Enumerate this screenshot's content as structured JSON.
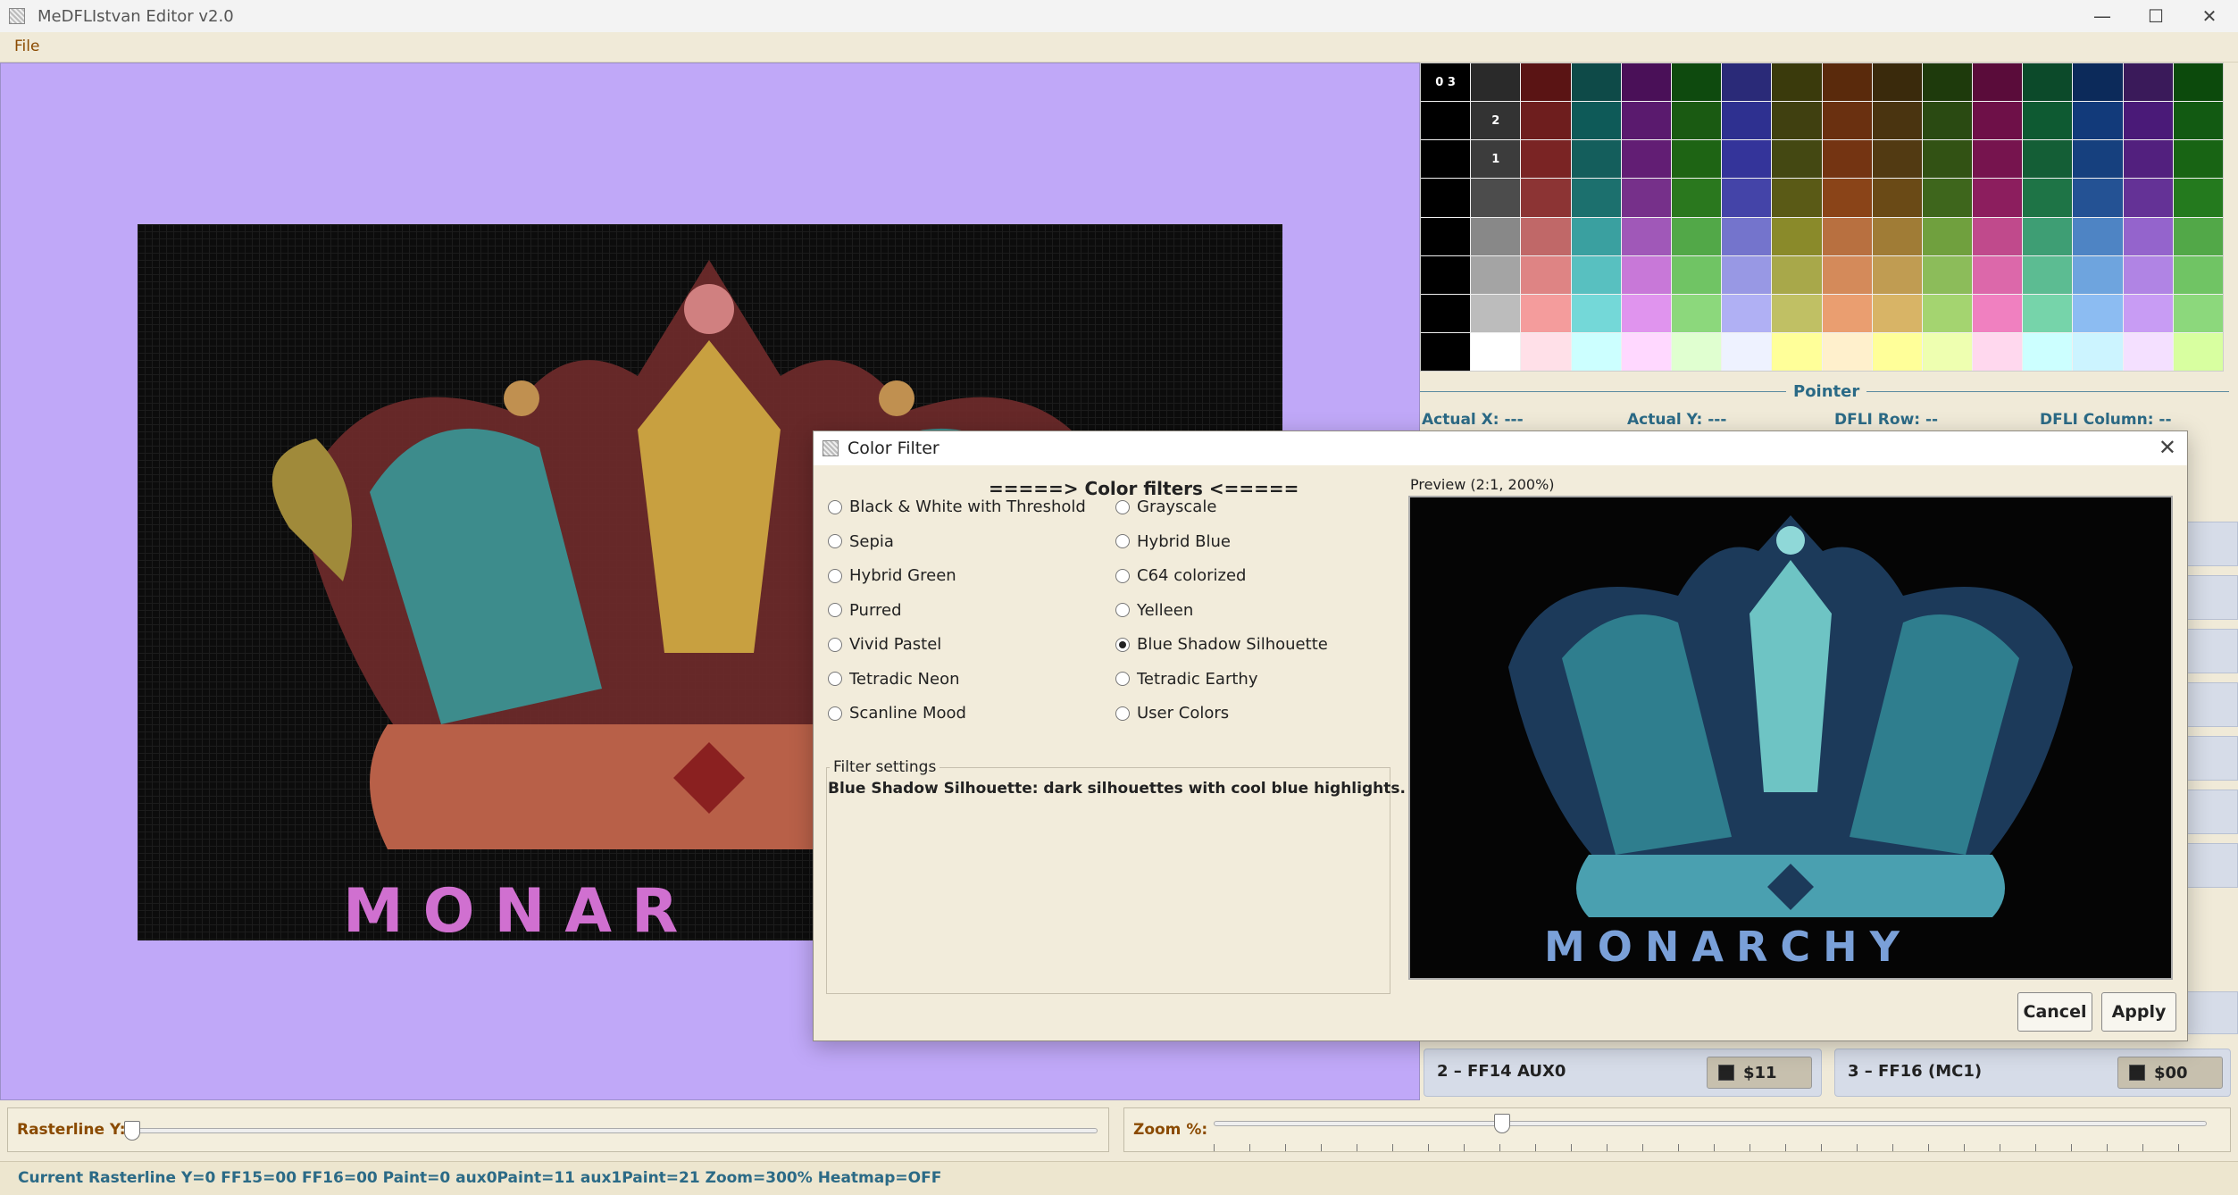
{
  "window": {
    "title": "MeDFLIstvan Editor v2.0"
  },
  "menu": {
    "file": "File"
  },
  "palette": {
    "cells": [
      "0 3",
      "",
      "",
      "",
      "",
      "",
      "",
      "",
      "",
      "",
      "",
      "",
      "",
      "",
      "",
      "",
      "",
      "2",
      "",
      "",
      "",
      "",
      "",
      "",
      "",
      "",
      "",
      "",
      "",
      "",
      "",
      "",
      "",
      "1",
      "",
      "",
      "",
      "",
      "",
      "",
      "",
      "",
      "",
      "",
      "",
      "",
      "",
      "",
      "",
      "",
      "",
      "",
      "",
      "",
      "",
      "",
      "",
      "",
      "",
      "",
      "",
      "",
      "",
      "",
      "",
      "",
      "",
      "",
      "",
      "",
      "",
      "",
      "",
      "",
      "",
      "",
      "",
      "",
      "",
      "",
      "",
      "",
      "",
      "",
      "",
      "",
      "",
      "",
      "",
      "",
      "",
      "",
      "",
      "",
      "",
      "",
      "",
      "",
      "",
      "",
      "",
      "",
      "",
      "",
      "",
      "",
      "",
      "",
      "",
      "",
      "",
      "",
      "",
      ""
    ],
    "colors": [
      [
        "#000000",
        "#2a2a2a",
        "#5a1414",
        "#0e4a48",
        "#4a1058",
        "#0e4a0e",
        "#2a2a78",
        "#3a3a0c",
        "#5a2a0c",
        "#3a2a0c",
        "#1e3a0c",
        "#5a0c3a",
        "#0c4a2a",
        "#0c2a5a",
        "#3a1a5a",
        "#0c4a0c"
      ],
      [
        "#000000",
        "#333333",
        "#6e1e1e",
        "#0e5a58",
        "#5a1a6e",
        "#1a5a12",
        "#2e3090",
        "#404010",
        "#6a3010",
        "#4a3410",
        "#2a4a12",
        "#6e1048",
        "#0e5a32",
        "#123a7a",
        "#4a1a78",
        "#125a12"
      ],
      [
        "#000000",
        "#3c3c3c",
        "#7a2424",
        "#145e5c",
        "#621e74",
        "#1e6414",
        "#34349a",
        "#444812",
        "#743412",
        "#523a12",
        "#325214",
        "#76144e",
        "#145e36",
        "#16407e",
        "#52207e",
        "#186414"
      ],
      [
        "#000000",
        "#4c4c4c",
        "#8c3434",
        "#1c706e",
        "#76308a",
        "#2a781e",
        "#4444a8",
        "#5a5a16",
        "#8a4418",
        "#6a4a16",
        "#3e661c",
        "#8c1e5e",
        "#1e7446",
        "#245294",
        "#643296",
        "#247a1e"
      ],
      [
        "#000000",
        "#888888",
        "#c06868",
        "#3aa0a0",
        "#a058b8",
        "#52a848",
        "#7474cc",
        "#8a8a2a",
        "#b87040",
        "#a07c36",
        "#70a03e",
        "#c04a8c",
        "#3e9e74",
        "#4e84c4",
        "#9464cc",
        "#52a848"
      ],
      [
        "#000000",
        "#a4a4a4",
        "#de8484",
        "#58c0c0",
        "#c878d8",
        "#70c464",
        "#9898e4",
        "#a8a84a",
        "#d48a5a",
        "#c09c52",
        "#8cbc5a",
        "#dc68aa",
        "#5cbc92",
        "#6ea4de",
        "#b084e4",
        "#70c464"
      ],
      [
        "#000000",
        "#bcbcbc",
        "#f49c9c",
        "#74d8d8",
        "#e094ee",
        "#8cd87c",
        "#b0b0f4",
        "#c0c064",
        "#ea9e70",
        "#d8b466",
        "#a4d470",
        "#f080c0",
        "#76d4aa",
        "#8cbcf2",
        "#c89cf4",
        "#8cd87c"
      ],
      [
        "#000000",
        "#ffffff",
        "#ffe0e8",
        "#ccffff",
        "#ffd8ff",
        "#e0ffd0",
        "#eef2ff",
        "#ffff99",
        "#fff0cc",
        "#ffff99",
        "#eeffb0",
        "#ffd8ee",
        "#ccffff",
        "#ccf4ff",
        "#f4e0ff",
        "#d8ffa0"
      ]
    ]
  },
  "pointer": {
    "title": "Pointer",
    "actual_x": "Actual X: ---",
    "actual_y": "Actual Y: ---",
    "dfli_row": "DFLI Row: --",
    "dfli_column": "DFLI Column: --"
  },
  "image": {
    "caption_main": "MONAR",
    "caption_preview": "MONARCHY"
  },
  "swatch_panels": [
    {
      "label": "2 – FF14 AUX0",
      "value": "$11"
    },
    {
      "label": "3 – FF16 (MC1)",
      "value": "$00"
    }
  ],
  "sliders": {
    "raster_label": "Rasterline Y:",
    "zoom_label": "Zoom %:",
    "raster_value": 0,
    "zoom_value": 300
  },
  "status": "Current Rasterline Y=0  FF15=00  FF16=00  Paint=0  aux0Paint=11  aux1Paint=21  Zoom=300%  Heatmap=OFF",
  "dialog": {
    "title": "Color Filter",
    "heading": "=====> Color filters <=====",
    "filters_left": [
      "Black & White with Threshold",
      "Sepia",
      "Hybrid Green",
      "Purred",
      "Vivid Pastel",
      "Tetradic Neon",
      "Scanline Mood"
    ],
    "filters_right": [
      "Grayscale",
      "Hybrid Blue",
      "C64 colorized",
      "Yelleen",
      "Blue Shadow Silhouette",
      "Tetradic Earthy",
      "User Colors"
    ],
    "selected": "Blue Shadow Silhouette",
    "settings_legend": "Filter settings",
    "settings_text": "Blue Shadow Silhouette: dark silhouettes with cool blue highlights.",
    "preview_legend": "Preview (2:1, 200%)",
    "cancel": "Cancel",
    "apply": "Apply"
  }
}
